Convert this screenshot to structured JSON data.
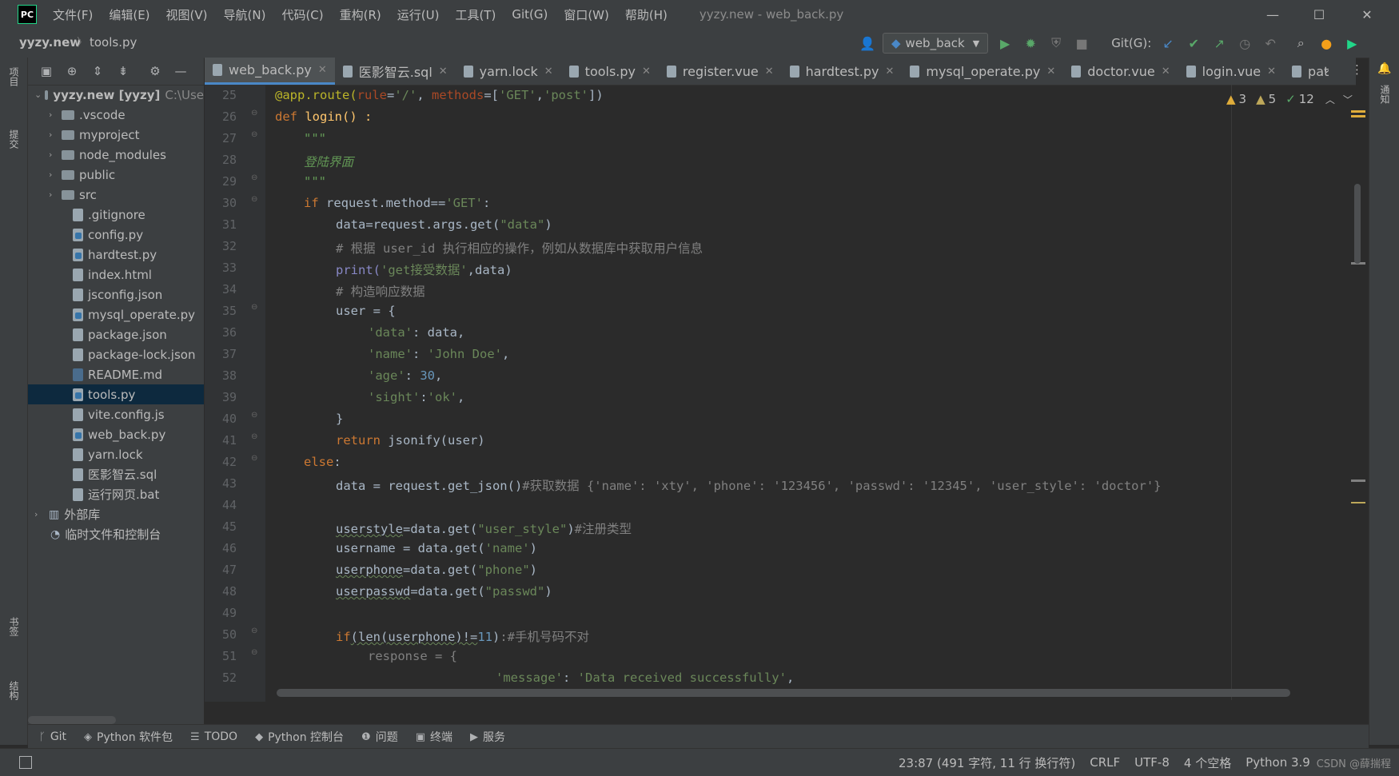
{
  "titlebar": {
    "logo": "PC",
    "menu": [
      "文件(F)",
      "编辑(E)",
      "视图(V)",
      "导航(N)",
      "代码(C)",
      "重构(R)",
      "运行(U)",
      "工具(T)",
      "Git(G)",
      "窗口(W)",
      "帮助(H)"
    ],
    "window_title": "yyzy.new - web_back.py",
    "minimize": "—",
    "maximize": "☐",
    "close": "✕"
  },
  "navbar": {
    "project": "yyzy.new",
    "separator": "〉",
    "file": "tools.py",
    "run_config": "web_back",
    "git_label": "Git(G):"
  },
  "left_strip": {
    "project_tab": "项目",
    "commit_tab": "提交",
    "bookmark_tab": "书签",
    "structure_tab": "结构"
  },
  "right_strip": {
    "notifications_tab": "通知"
  },
  "project_tree": {
    "root_name": "yyzy.new [yyzy]",
    "root_path": "C:\\Use",
    "folders": [
      ".vscode",
      "myproject",
      "node_modules",
      "public",
      "src"
    ],
    "files": [
      ".gitignore",
      "config.py",
      "hardtest.py",
      "index.html",
      "jsconfig.json",
      "mysql_operate.py",
      "package.json",
      "package-lock.json",
      "README.md",
      "tools.py",
      "vite.config.js",
      "web_back.py",
      "yarn.lock",
      "医影智云.sql",
      "运行网页.bat"
    ],
    "external_libs": "外部库",
    "scratches": "临时文件和控制台"
  },
  "tabs": [
    {
      "label": "web_back.py"
    },
    {
      "label": "医影智云.sql"
    },
    {
      "label": "yarn.lock"
    },
    {
      "label": "tools.py"
    },
    {
      "label": "register.vue"
    },
    {
      "label": "hardtest.py"
    },
    {
      "label": "mysql_operate.py"
    },
    {
      "label": "doctor.vue"
    },
    {
      "label": "login.vue"
    },
    {
      "label": "pat"
    }
  ],
  "inspections": {
    "warnings": "3",
    "weak_warnings": "5",
    "typos": "12"
  },
  "line_numbers": [
    "25",
    "26",
    "27",
    "28",
    "29",
    "30",
    "31",
    "32",
    "33",
    "34",
    "35",
    "36",
    "37",
    "38",
    "39",
    "40",
    "41",
    "42",
    "43",
    "44",
    "45",
    "46",
    "47",
    "48",
    "49",
    "50",
    "51",
    "52"
  ],
  "code": {
    "l25_dec": "@app.route(",
    "l25_rule": "rule",
    "l25_a": "=",
    "l25_s1": "'/'",
    "l25_b": ", ",
    "l25_methods": "methods",
    "l25_c": "=[",
    "l25_s2": "'GET'",
    "l25_d": ",",
    "l25_s3": "'post'",
    "l25_e": "])",
    "l26_kw": "def ",
    "l26_rest": "login() :",
    "l27": "\"\"\"",
    "l28": "登陆界面",
    "l29": "\"\"\"",
    "l30_kw": "if ",
    "l30_a": "request.method==",
    "l30_s": "'GET'",
    "l30_b": ":",
    "l31_a": "data=request.args.get(",
    "l31_s": "\"data\"",
    "l31_b": ")",
    "l32": "# 根据 user_id 执行相应的操作，例如从数据库中获取用户信息",
    "l33_a": "print(",
    "l33_s": "'get接受数据'",
    "l33_b": ",data)",
    "l34": "# 构造响应数据",
    "l35": "user = {",
    "l36_s": "'data'",
    "l36_b": ": data,",
    "l37_s": "'name'",
    "l37_b": ": ",
    "l37_s2": "'John Doe'",
    "l37_c": ",",
    "l38_s": "'age'",
    "l38_b": ": ",
    "l38_n": "30",
    "l38_c": ",",
    "l39_s": "'sight'",
    "l39_b": ":",
    "l39_s2": "'ok'",
    "l39_c": ",",
    "l40": "}",
    "l41_kw": "return ",
    "l41_b": "jsonify(user)",
    "l42_kw": "else",
    "l42_b": ":",
    "l43_a": "data = request.get_json()",
    "l43_c": "#获取数据 {'name': 'xty', 'phone': '123456', 'passwd': '12345', 'user_style': 'doctor'}",
    "l45_u": "userstyle",
    "l45_a": "=data.get(",
    "l45_s": "\"user_style\"",
    "l45_b": ")",
    "l45_c": "#注册类型",
    "l46_a": "username = data.get(",
    "l46_s": "'name'",
    "l46_b": ")",
    "l47_u": "userphone",
    "l47_a": "=data.get(",
    "l47_s": "\"phone\"",
    "l47_b": ")",
    "l48_u": "userpasswd",
    "l48_a": "=data.get(",
    "l48_s": "\"passwd\"",
    "l48_b": ")",
    "l50_kw": "if",
    "l50_u": "(len(userphone)!=",
    "l50_n": "11",
    "l50_b": ")",
    "l50_c": ":#手机号码不对",
    "l51": "response = {",
    "l52_s": "'message'",
    "l52_b": ": ",
    "l52_s2": "'Data received successfully'",
    "l52_c": ","
  },
  "tool_tabs": [
    "Git",
    "Python 软件包",
    "TODO",
    "Python 控制台",
    "问题",
    "终端",
    "服务"
  ],
  "statusbar": {
    "position": "23:87 (491 字符, 11 行 换行符)",
    "line_ending": "CRLF",
    "encoding": "UTF-8",
    "indent": "4 个空格",
    "interpreter": "Python 3.9",
    "watermark": "CSDN @薛揣程"
  }
}
